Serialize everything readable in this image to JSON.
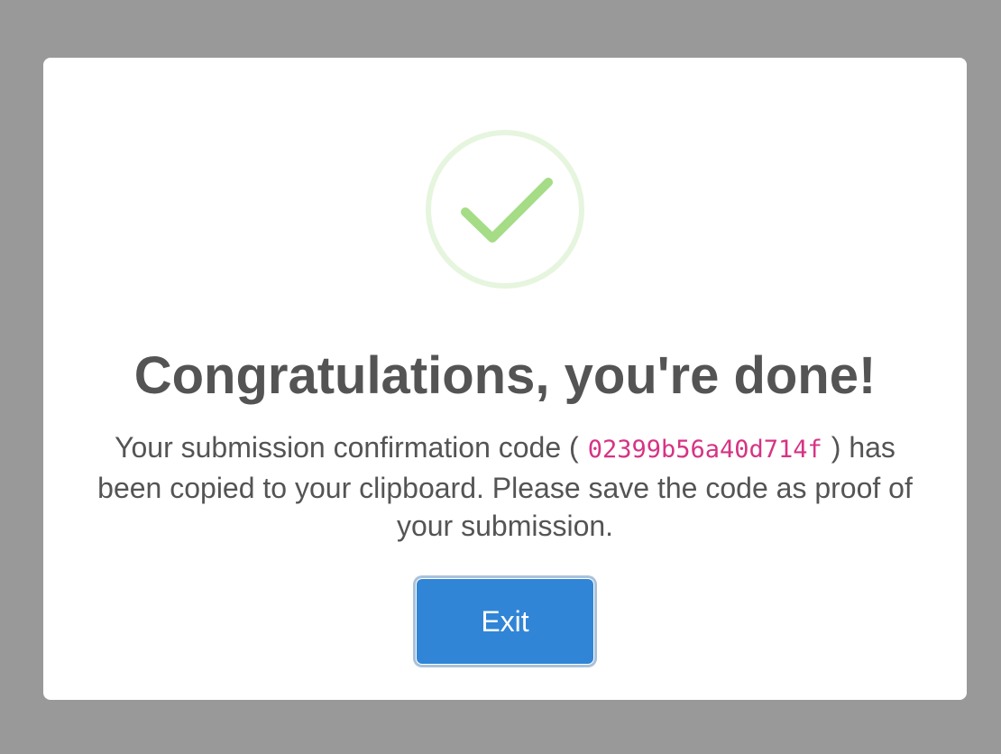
{
  "dialog": {
    "title": "Congratulations, you're done!",
    "message_before_code": "Your submission confirmation code (",
    "confirmation_code": "02399b56a40d714f",
    "message_after_code": ") has been copied to your clipboard. Please save the code as proof of your submission.",
    "exit_label": "Exit",
    "icon": "check-circle-icon"
  },
  "colors": {
    "backdrop": "#999999",
    "dialog_background": "#ffffff",
    "text": "#545454",
    "code": "#d63384",
    "success": "#a5dc86",
    "success_ring": "#e6f5de",
    "button": "#3085d6"
  }
}
